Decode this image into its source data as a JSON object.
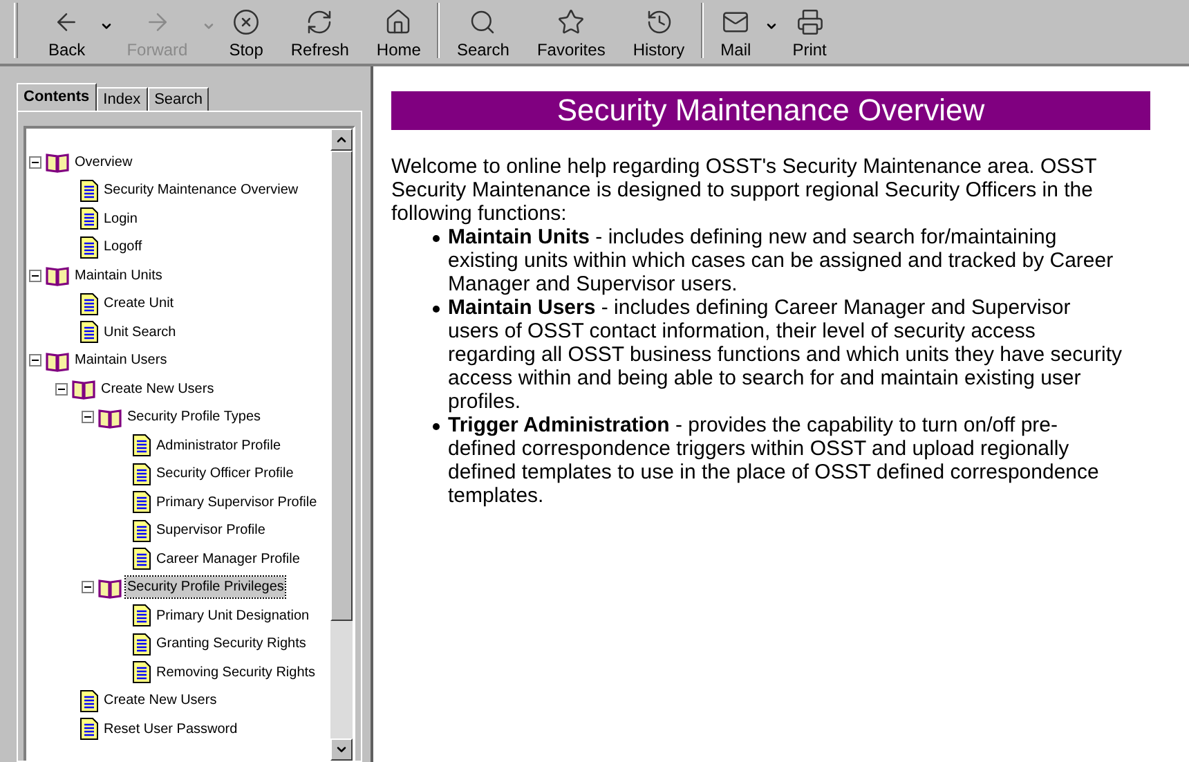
{
  "toolbar": {
    "groups": [
      [
        {
          "kind": "back",
          "label": "Back",
          "disabled": false,
          "dropdown": true
        },
        {
          "kind": "forward",
          "label": "Forward",
          "disabled": true,
          "dropdown": true
        },
        {
          "kind": "stop",
          "label": "Stop",
          "disabled": false,
          "dropdown": false
        },
        {
          "kind": "refresh",
          "label": "Refresh",
          "disabled": false,
          "dropdown": false
        },
        {
          "kind": "home",
          "label": "Home",
          "disabled": false,
          "dropdown": false
        }
      ],
      [
        {
          "kind": "search",
          "label": "Search",
          "disabled": false,
          "dropdown": false
        },
        {
          "kind": "favorites",
          "label": "Favorites",
          "disabled": false,
          "dropdown": false
        },
        {
          "kind": "history",
          "label": "History",
          "disabled": false,
          "dropdown": false
        }
      ],
      [
        {
          "kind": "mail",
          "label": "Mail",
          "disabled": false,
          "dropdown": true
        },
        {
          "kind": "print",
          "label": "Print",
          "disabled": false,
          "dropdown": false
        }
      ]
    ]
  },
  "tabs": [
    {
      "label": "Contents",
      "selected": true
    },
    {
      "label": "Index",
      "selected": false
    },
    {
      "label": "Search",
      "selected": false
    }
  ],
  "tree": [
    {
      "kind": "book",
      "label": "Overview",
      "expanded": true,
      "selected": false,
      "children": [
        {
          "kind": "page",
          "label": "Security Maintenance Overview",
          "selected": false
        },
        {
          "kind": "page",
          "label": "Login",
          "selected": false
        },
        {
          "kind": "page",
          "label": "Logoff",
          "selected": false
        }
      ]
    },
    {
      "kind": "book",
      "label": "Maintain Units",
      "expanded": true,
      "selected": false,
      "children": [
        {
          "kind": "page",
          "label": "Create Unit",
          "selected": false
        },
        {
          "kind": "page",
          "label": "Unit Search",
          "selected": false
        }
      ]
    },
    {
      "kind": "book",
      "label": "Maintain Users",
      "expanded": true,
      "selected": false,
      "children": [
        {
          "kind": "book",
          "label": "Create New Users",
          "expanded": true,
          "selected": false,
          "children": [
            {
              "kind": "book",
              "label": "Security Profile Types",
              "expanded": true,
              "selected": false,
              "children": [
                {
                  "kind": "page",
                  "label": "Administrator Profile",
                  "selected": false
                },
                {
                  "kind": "page",
                  "label": "Security Officer Profile",
                  "selected": false
                },
                {
                  "kind": "page",
                  "label": "Primary Supervisor Profile",
                  "selected": false
                },
                {
                  "kind": "page",
                  "label": "Supervisor Profile",
                  "selected": false
                },
                {
                  "kind": "page",
                  "label": "Career Manager Profile",
                  "selected": false
                }
              ]
            },
            {
              "kind": "book",
              "label": "Security Profile Privileges",
              "expanded": true,
              "selected": true,
              "children": [
                {
                  "kind": "page",
                  "label": "Primary Unit Designation",
                  "selected": false
                },
                {
                  "kind": "page",
                  "label": "Granting Security Rights",
                  "selected": false
                },
                {
                  "kind": "page",
                  "label": "Removing Security Rights",
                  "selected": false
                }
              ]
            }
          ]
        },
        {
          "kind": "page",
          "label": "Create New Users",
          "selected": false
        },
        {
          "kind": "page",
          "label": "Reset User Password",
          "selected": false
        }
      ]
    }
  ],
  "content": {
    "title": "Security Maintenance Overview",
    "intro": "Welcome to online help regarding OSST's Security Maintenance area.  OSST Security Maintenance is designed to support regional Security Officers in the following functions:",
    "bullets": [
      "**Maintain Units** - includes defining new and search for/maintaining existing units within which cases can be assigned and tracked by Career Manager and Supervisor users.",
      "**Maintain Users** - includes defining Career Manager and Supervisor users of OSST contact information, their level of security access regarding all OSST business functions and which units they have security access within and being able to search for and maintain existing user profiles.",
      "**Trigger Administration** - provides the capability to turn on/off pre-defined correspondence triggers within OSST and upload regionally defined templates to use in the place of OSST defined correspondence templates."
    ]
  }
}
